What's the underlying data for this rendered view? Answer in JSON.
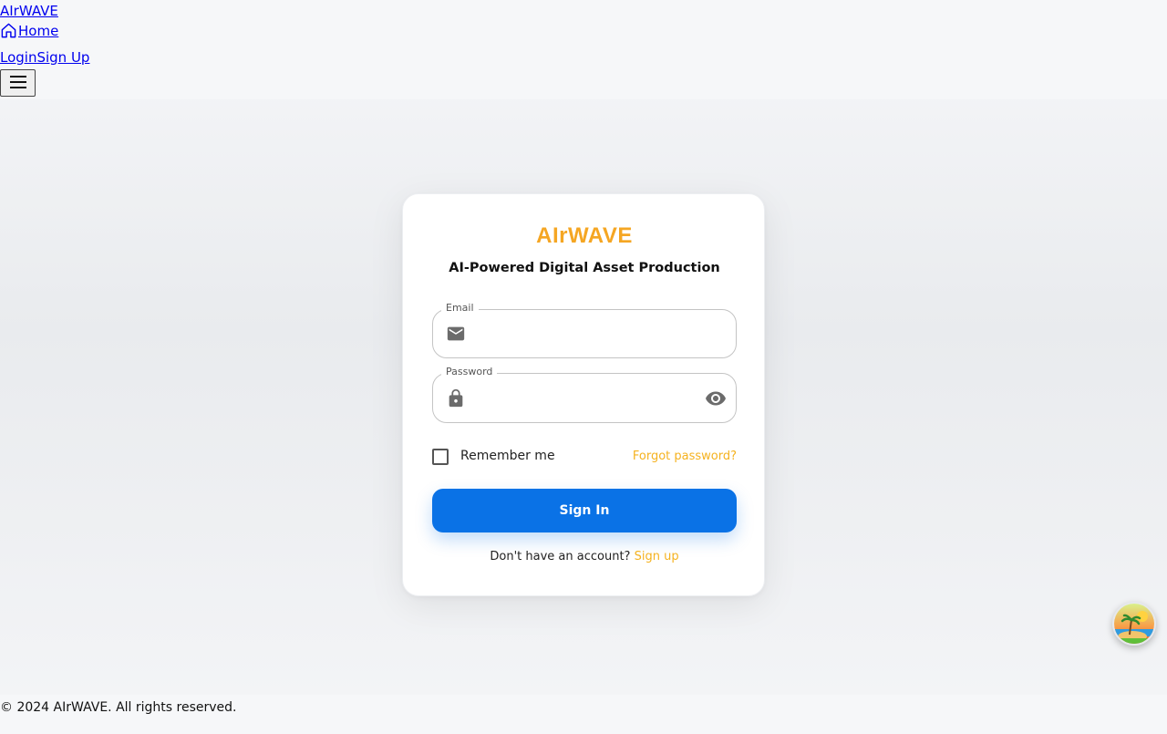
{
  "header": {
    "brand": "AIrWAVE",
    "home_label": "Home",
    "login_label": "Login",
    "signup_label": "Sign Up"
  },
  "card": {
    "logo": "AIrWAVE",
    "tagline": "AI-Powered Digital Asset Production",
    "email": {
      "label": "Email",
      "value": "",
      "icon": "mail-icon"
    },
    "password": {
      "label": "Password",
      "value": "",
      "icon": "lock-icon",
      "toggle_icon": "eye-icon"
    },
    "remember_label": "Remember me",
    "remember_checked": false,
    "forgot_label": "Forgot password?",
    "signin_label": "Sign In",
    "signup_prompt": "Don't have an account?",
    "signup_link": "Sign up"
  },
  "footer": {
    "copyright": "© 2024 AIrWAVE. All rights reserved."
  },
  "colors": {
    "accent": "#f5a623",
    "link_accent": "#f5b21f",
    "primary_button": "#0a72e6"
  }
}
